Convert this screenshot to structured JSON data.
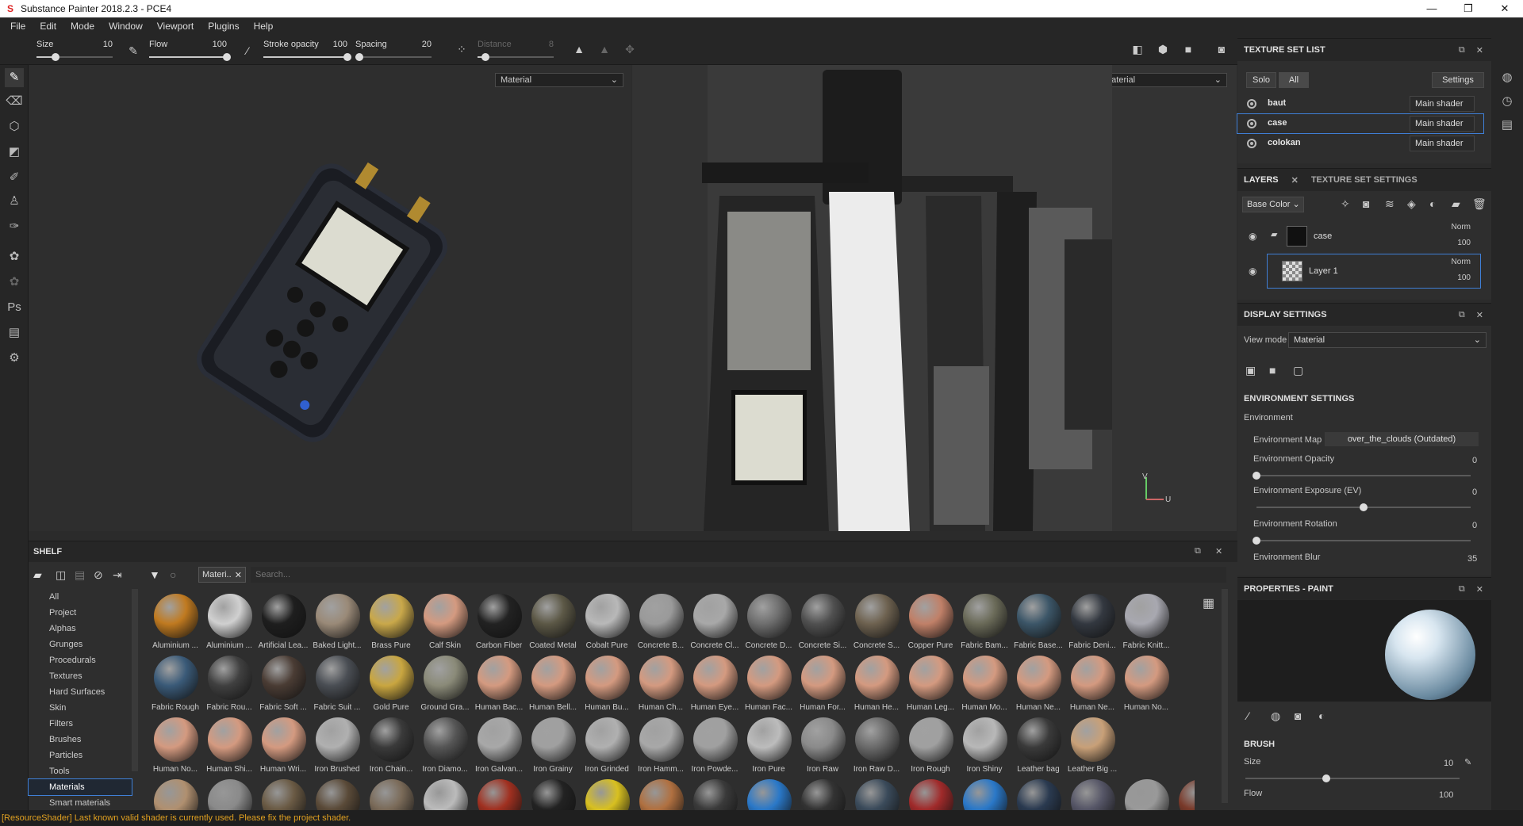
{
  "window": {
    "title": "Substance Painter 2018.2.3 - PCE4",
    "minimize": "—",
    "maximize": "❐",
    "close": "✕"
  },
  "menu": [
    "File",
    "Edit",
    "Mode",
    "Window",
    "Viewport",
    "Plugins",
    "Help"
  ],
  "toolbar": {
    "size": {
      "label": "Size",
      "value": "10",
      "level": 0.25
    },
    "flow": {
      "label": "Flow",
      "value": "100",
      "level": 1.0
    },
    "stroke_opacity": {
      "label": "Stroke opacity",
      "value": "100",
      "level": 1.0
    },
    "spacing": {
      "label": "Spacing",
      "value": "20",
      "level": 0.05
    },
    "distance": {
      "label": "Distance",
      "value": "8",
      "level": 0.1
    }
  },
  "viewport2d": {
    "mode": "Material"
  },
  "viewport3d": {
    "mode": "Material",
    "axis_v": "V",
    "axis_u": "U"
  },
  "texture_set_list": {
    "title": "TEXTURE SET LIST",
    "solo": "Solo",
    "all": "All",
    "settings": "Settings",
    "sets": [
      {
        "name": "baut",
        "shader": "Main shader"
      },
      {
        "name": "case",
        "shader": "Main shader"
      },
      {
        "name": "colokan",
        "shader": "Main shader"
      }
    ]
  },
  "layers": {
    "tab_layers": "LAYERS",
    "tab_tss": "TEXTURE SET SETTINGS",
    "channel": "Base Color",
    "items": [
      {
        "name": "case",
        "blend": "Norm",
        "opacity": "100"
      },
      {
        "name": "Layer 1",
        "blend": "Norm",
        "opacity": "100"
      }
    ]
  },
  "display_settings": {
    "title": "DISPLAY SETTINGS",
    "view_mode_label": "View mode",
    "view_mode": "Material",
    "env_settings": "ENVIRONMENT SETTINGS",
    "environment": "Environment",
    "env_map_label": "Environment Map",
    "env_map": "over_the_clouds (Outdated)",
    "env_opacity_label": "Environment Opacity",
    "env_opacity": "0",
    "env_exposure_label": "Environment Exposure (EV)",
    "env_exposure": "0",
    "env_rotation_label": "Environment Rotation",
    "env_rotation": "0",
    "env_blur_label": "Environment Blur",
    "env_blur": "35"
  },
  "properties": {
    "title": "PROPERTIES - PAINT",
    "brush": "BRUSH",
    "size_label": "Size",
    "size": "10",
    "flow_label": "Flow",
    "flow": "100"
  },
  "shelf": {
    "title": "SHELF",
    "filter_tag": "Materi..",
    "search_placeholder": "Search...",
    "categories": [
      "All",
      "Project",
      "Alphas",
      "Grunges",
      "Procedurals",
      "Textures",
      "Hard Surfaces",
      "Skin",
      "Filters",
      "Brushes",
      "Particles",
      "Tools",
      "Materials",
      "Smart materials"
    ],
    "selected_category": "Materials",
    "materials": [
      {
        "name": "Aluminium ...",
        "color": "#c07a20"
      },
      {
        "name": "Aluminium ...",
        "color": "#d0d0d0"
      },
      {
        "name": "Artificial Lea...",
        "color": "#1e1e1e"
      },
      {
        "name": "Baked Light...",
        "color": "#9a8a78"
      },
      {
        "name": "Brass Pure",
        "color": "#c9a84a"
      },
      {
        "name": "Calf Skin",
        "color": "#d49a80"
      },
      {
        "name": "Carbon Fiber",
        "color": "#222"
      },
      {
        "name": "Coated Metal",
        "color": "#5c5846"
      },
      {
        "name": "Cobalt Pure",
        "color": "#b8b8b8"
      },
      {
        "name": "Concrete B...",
        "color": "#9a9a9a"
      },
      {
        "name": "Concrete Cl...",
        "color": "#a8a8a8"
      },
      {
        "name": "Concrete D...",
        "color": "#6e6e6e"
      },
      {
        "name": "Concrete Si...",
        "color": "#505050"
      },
      {
        "name": "Concrete S...",
        "color": "#6e6250"
      },
      {
        "name": "Copper Pure",
        "color": "#c08068"
      },
      {
        "name": "Fabric Bam...",
        "color": "#6a6a58"
      },
      {
        "name": "Fabric Base...",
        "color": "#3c5668"
      },
      {
        "name": "Fabric Deni...",
        "color": "#333840"
      },
      {
        "name": "Fabric Knitt...",
        "color": "#a8a8b0"
      },
      {
        "name": "Fabric Rough",
        "color": "#3a5a78"
      },
      {
        "name": "Fabric Rou...",
        "color": "#404040"
      },
      {
        "name": "Fabric Soft ...",
        "color": "#4a3c34"
      },
      {
        "name": "Fabric Suit ...",
        "color": "#4a4e54"
      },
      {
        "name": "Gold Pure",
        "color": "#c9a640"
      },
      {
        "name": "Ground Gra...",
        "color": "#8a8a78"
      },
      {
        "name": "Human Bac...",
        "color": "#d49a80"
      },
      {
        "name": "Human Bell...",
        "color": "#d49a80"
      },
      {
        "name": "Human Bu...",
        "color": "#d49a80"
      },
      {
        "name": "Human Ch...",
        "color": "#d49a80"
      },
      {
        "name": "Human Eye...",
        "color": "#d49a80"
      },
      {
        "name": "Human Fac...",
        "color": "#d49a80"
      },
      {
        "name": "Human For...",
        "color": "#d49a80"
      },
      {
        "name": "Human He...",
        "color": "#d49a80"
      },
      {
        "name": "Human Leg...",
        "color": "#d49a80"
      },
      {
        "name": "Human Mo...",
        "color": "#d49a80"
      },
      {
        "name": "Human Ne...",
        "color": "#d49a80"
      },
      {
        "name": "Human Ne...",
        "color": "#d49a80"
      },
      {
        "name": "Human No...",
        "color": "#d49a80"
      },
      {
        "name": "Human No...",
        "color": "#d49a80"
      },
      {
        "name": "Human Shi...",
        "color": "#d49a80"
      },
      {
        "name": "Human Wri...",
        "color": "#d49a80"
      },
      {
        "name": "Iron Brushed",
        "color": "#b0b0b0"
      },
      {
        "name": "Iron Chain...",
        "color": "#3a3a3a"
      },
      {
        "name": "Iron Diamo...",
        "color": "#555"
      },
      {
        "name": "Iron Galvan...",
        "color": "#a8a8a8"
      },
      {
        "name": "Iron Grainy",
        "color": "#a0a0a0"
      },
      {
        "name": "Iron Grinded",
        "color": "#b0b0b0"
      },
      {
        "name": "Iron Hamm...",
        "color": "#a8a8a8"
      },
      {
        "name": "Iron Powde...",
        "color": "#a0a0a0"
      },
      {
        "name": "Iron Pure",
        "color": "#bcbcbc"
      },
      {
        "name": "Iron Raw",
        "color": "#8a8a8a"
      },
      {
        "name": "Iron Raw D...",
        "color": "#6a6a6a"
      },
      {
        "name": "Iron Rough",
        "color": "#a0a0a0"
      },
      {
        "name": "Iron Shiny",
        "color": "#b8b8b8"
      },
      {
        "name": "Leather bag",
        "color": "#3a3a3a"
      },
      {
        "name": "Leather Big ...",
        "color": "#c8a078"
      }
    ],
    "partial_row": [
      "#b09070",
      "#8a8a8a",
      "#6a5a44",
      "#5a4a38",
      "#7a6a58",
      "#bbb",
      "#a03020",
      "#222",
      "#d8c020",
      "#b07040",
      "#3a3a3a",
      "#2a78c8",
      "#333",
      "#3a4a5a",
      "#a02a2a",
      "#2a78c8",
      "#2a3a50",
      "#556",
      "#999",
      "#7a3a2a"
    ]
  },
  "status": "[ResourceShader] Last known valid shader is currently used. Please fix the project shader."
}
